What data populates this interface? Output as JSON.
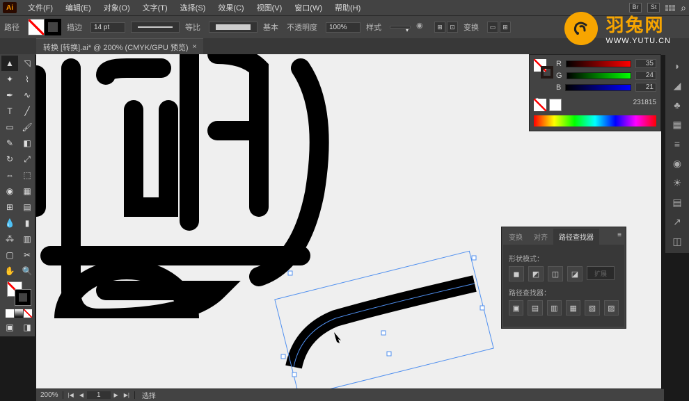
{
  "app": {
    "logo": "Ai"
  },
  "menu": {
    "file": "文件(F)",
    "edit": "编辑(E)",
    "object": "对象(O)",
    "type": "文字(T)",
    "select": "选择(S)",
    "effect": "效果(C)",
    "view": "视图(V)",
    "window": "窗口(W)",
    "help": "帮助(H)"
  },
  "menubar_icons": {
    "br": "Br",
    "st": "St"
  },
  "control": {
    "label": "路径",
    "stroke_label": "描边",
    "stroke_width": "14 pt",
    "uniform": "等比",
    "basic": "基本",
    "opacity_label": "不透明度",
    "opacity_value": "100%",
    "style_label": "样式",
    "transform_label": "变换"
  },
  "tab": {
    "title": "转换  [转换].ai* @ 200% (CMYK/GPU 预览)",
    "close": "×"
  },
  "color_panel": {
    "r_label": "R",
    "g_label": "G",
    "b_label": "B",
    "r": "35",
    "g": "24",
    "b": "21",
    "hex": "231815"
  },
  "pathfinder": {
    "tab_transform": "变换",
    "tab_align": "对齐",
    "tab_pathfinder": "路径查找器",
    "shape_modes": "形状模式：",
    "pathfinders": "路径查找器：",
    "expand": "扩展"
  },
  "status": {
    "zoom": "200%",
    "page": "1",
    "selection": "选择"
  },
  "watermark": {
    "cn": "羽兔网",
    "en": "WWW.YUTU.CN"
  }
}
